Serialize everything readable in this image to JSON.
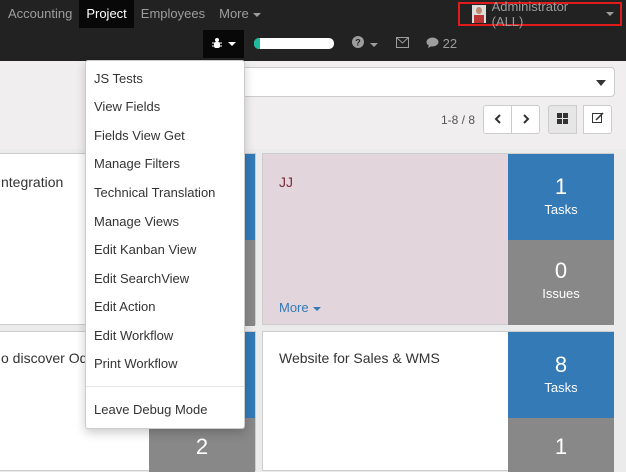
{
  "menu": {
    "items": [
      {
        "label": "Accounting"
      },
      {
        "label": "Project"
      },
      {
        "label": "Employees"
      },
      {
        "label": "More"
      }
    ]
  },
  "user": {
    "label": "Administrator (ALL)"
  },
  "systray": {
    "progress": 0.08,
    "chat_count": "22",
    "icons": [
      "bug-icon",
      "help-icon",
      "mail-icon",
      "chat-icon"
    ]
  },
  "debug_menu": {
    "items": [
      "JS Tests",
      "View Fields",
      "Fields View Get",
      "Manage Filters",
      "Technical Translation",
      "Manage Views",
      "Edit Kanban View",
      "Edit SearchView",
      "Edit Action",
      "Edit Workflow",
      "Print Workflow"
    ],
    "leave": "Leave Debug Mode"
  },
  "pager": {
    "label": "1-8 / 8"
  },
  "cards": [
    {
      "title": "ntegration"
    },
    {
      "title": "JJ",
      "more": "More",
      "tasks_count": "1",
      "tasks_label": "Tasks",
      "issues_count": "0",
      "issues_label": "Issues"
    },
    {
      "title": "o discover Od",
      "bottom_count": "2"
    },
    {
      "title": "Website for Sales & WMS",
      "tasks_count": "8",
      "tasks_label": "Tasks",
      "bottom_count": "1"
    }
  ],
  "colors": {
    "accent_blue": "#337ab7",
    "stat_gray": "#888888",
    "card_pink": "#e2d5dc",
    "highlight_red": "#e01b1b"
  }
}
